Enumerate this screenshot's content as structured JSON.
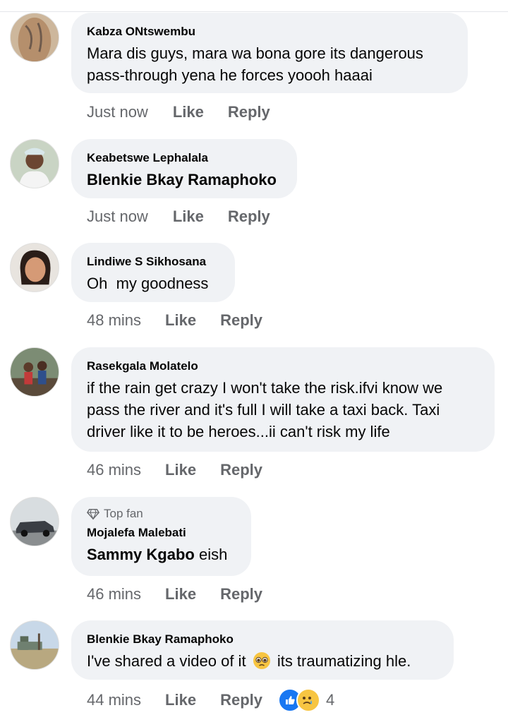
{
  "comments": [
    {
      "author": "Kabza ONtswembu",
      "text": "Mara dis guys, mara wa bona gore its dangerous pass-through yena he forces yoooh haaai",
      "time": "Just now",
      "like": "Like",
      "reply": "Reply"
    },
    {
      "author": "Keabetswe Lephalala",
      "mention": "Blenkie Bkay Ramaphoko",
      "time": "Just now",
      "like": "Like",
      "reply": "Reply"
    },
    {
      "author": "Lindiwe S Sikhosana",
      "text": "Oh  my goodness",
      "time": "48 mins",
      "like": "Like",
      "reply": "Reply"
    },
    {
      "author": "Rasekgala Molatelo",
      "text": "if the rain get crazy I won't take the risk.ifvi know we pass the river and it's full I will take a taxi back. Taxi driver like it to be heroes...ii can't risk my life",
      "time": "46 mins",
      "like": "Like",
      "reply": "Reply"
    },
    {
      "badge": "Top fan",
      "author": "Mojalefa Malebati",
      "mention": "Sammy Kgabo",
      "text": "eish",
      "time": "46 mins",
      "like": "Like",
      "reply": "Reply"
    },
    {
      "author": "Blenkie Bkay Ramaphoko",
      "text_before": "I've shared a video of it",
      "text_after": "its traumatizing hle.",
      "time": "44 mins",
      "like": "Like",
      "reply": "Reply",
      "reaction_count": "4"
    }
  ],
  "colors": {
    "bubble": "#f0f2f5",
    "meta": "#65676b",
    "like_blue": "#1877f2",
    "sad_yellow": "#f7c542"
  },
  "icons": [
    "top-fan-diamond-icon",
    "like-reaction-icon",
    "sad-reaction-icon",
    "pleading-face-emoji"
  ]
}
